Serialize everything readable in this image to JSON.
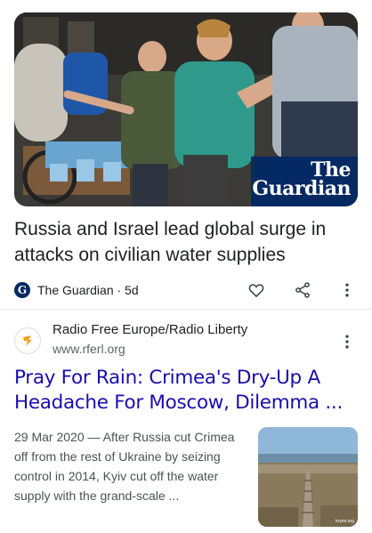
{
  "article1": {
    "badge_line1": "The",
    "badge_line2": "Guardian",
    "headline": "Russia and Israel lead global surge in attacks on civilian water supplies",
    "source_logo": "G",
    "source": "The Guardian · 5d",
    "icons": [
      "heart-icon",
      "share-icon",
      "more-vert-icon"
    ]
  },
  "article2": {
    "site_name": "Radio Free Europe/Radio Liberty",
    "site_url": "www.rferl.org",
    "headline": "Pray For Rain: Crimea's Dry-Up A Headache For Moscow, Dilemma ...",
    "snippet": "29 Mar 2020 — After Russia cut Crimea off from the rest of Ukraine by seizing control in 2014, Kyiv cut off the water supply with the grand-scale ...",
    "thumb_credit": "krymr.org",
    "icons": [
      "rferl-favicon-icon",
      "more-vert-icon"
    ]
  },
  "colors": {
    "guardian_blue": "#052962",
    "link_blue": "#1a0dab",
    "rferl_orange": "#f4a01e"
  }
}
